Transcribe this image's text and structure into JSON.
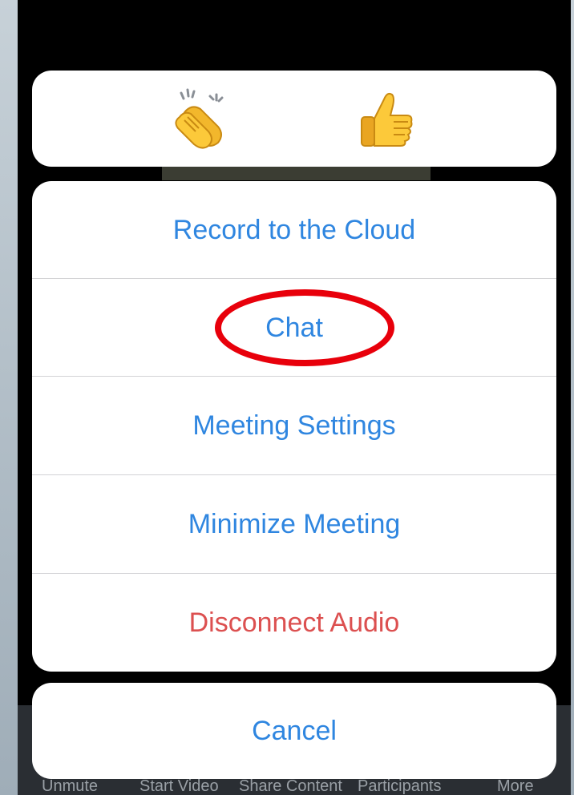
{
  "reactions": {
    "items": [
      {
        "icon": "clapping-hands-icon"
      },
      {
        "icon": "thumbs-up-icon"
      }
    ]
  },
  "action_sheet": {
    "items": [
      {
        "label": "Record to the Cloud",
        "style": "default"
      },
      {
        "label": "Chat",
        "style": "default",
        "highlighted": true
      },
      {
        "label": "Meeting Settings",
        "style": "default"
      },
      {
        "label": "Minimize Meeting",
        "style": "default"
      },
      {
        "label": "Disconnect Audio",
        "style": "destructive"
      }
    ],
    "cancel_label": "Cancel"
  },
  "toolbar": {
    "items": [
      {
        "label": "Unmute"
      },
      {
        "label": "Start Video"
      },
      {
        "label": "Share Content"
      },
      {
        "label": "Participants"
      },
      {
        "label": "More"
      }
    ]
  },
  "colors": {
    "action_blue": "#2f86e0",
    "destructive_red": "#dc5050",
    "highlight_ring": "#e8000b",
    "backdrop": "#000000"
  }
}
